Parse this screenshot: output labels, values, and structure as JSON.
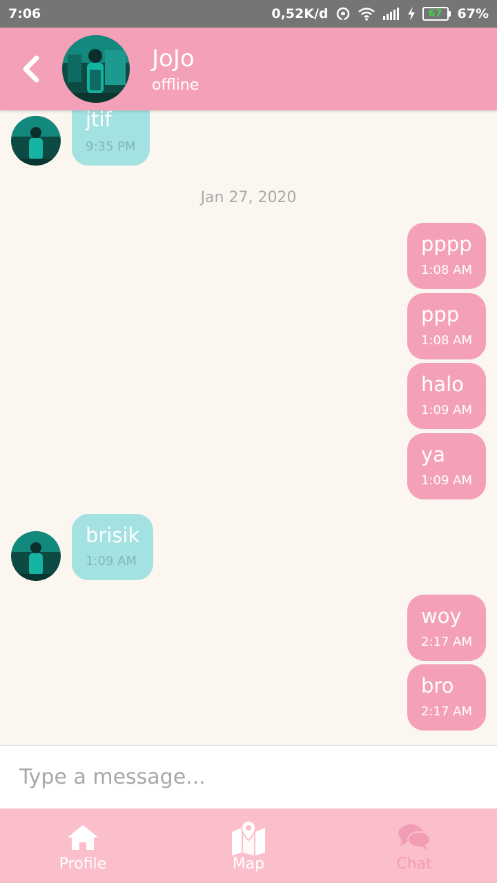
{
  "status_bar": {
    "time": "7:06",
    "net_speed": "0,52K/d",
    "battery_level": "67",
    "battery_percent": "67%"
  },
  "header": {
    "name": "JoJo",
    "status": "offline"
  },
  "chat": {
    "date_separator": "Jan 27, 2020",
    "messages": [
      {
        "direction": "in",
        "text": "jtif",
        "time": "9:35 PM"
      },
      {
        "direction": "out",
        "text": "pppp",
        "time": "1:08 AM"
      },
      {
        "direction": "out",
        "text": "ppp",
        "time": "1:08 AM"
      },
      {
        "direction": "out",
        "text": "halo",
        "time": "1:09 AM"
      },
      {
        "direction": "out",
        "text": "ya",
        "time": "1:09 AM"
      },
      {
        "direction": "in",
        "text": "brisik",
        "time": "1:09 AM"
      },
      {
        "direction": "out",
        "text": "woy",
        "time": "2:17 AM"
      },
      {
        "direction": "out",
        "text": "bro",
        "time": "2:17 AM"
      }
    ]
  },
  "input": {
    "placeholder": "Type a message..."
  },
  "nav": {
    "items": [
      {
        "label": "Profile",
        "icon": "home-icon"
      },
      {
        "label": "Map",
        "icon": "map-icon"
      },
      {
        "label": "Chat",
        "icon": "chat-icon"
      }
    ],
    "active": "Chat"
  },
  "colors": {
    "header": "#f4a0b8",
    "outgoing_bubble": "#f4a0b8",
    "incoming_bubble": "#a3e2e0",
    "nav": "#fbbfcc",
    "background": "#fbf7f0"
  }
}
